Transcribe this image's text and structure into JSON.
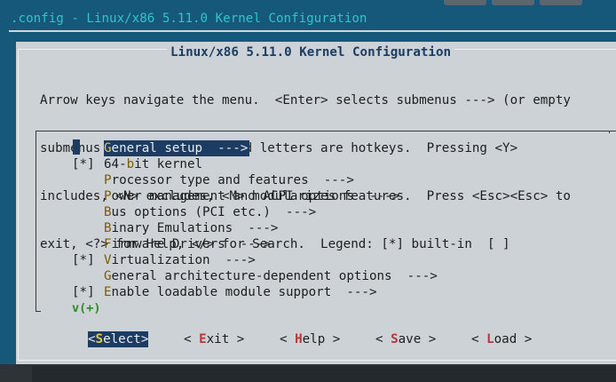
{
  "terminal": {
    "title": ".config - Linux/x86 5.11.0 Kernel Configuration"
  },
  "dialog": {
    "title": "Linux/x86 5.11.0 Kernel Configuration",
    "help_lines": [
      "Arrow keys navigate the menu.  <Enter> selects submenus ---> (or empty",
      "submenus ----).  Highlighted letters are hotkeys.  Pressing <Y>",
      "includes, <N> excludes, <M> modularizes features.  Press <Esc><Esc> to",
      "exit, <?> for Help, </> for Search.  Legend: [*] built-in  [ ]"
    ]
  },
  "menu": {
    "items": [
      {
        "prefix": "",
        "hotkey": "G",
        "rest": "eneral setup  --->"
      },
      {
        "prefix": "[*]",
        "pre": "64-",
        "hotkey": "b",
        "rest": "it kernel"
      },
      {
        "prefix": "",
        "hotkey": "P",
        "rest": "rocessor type and features  --->"
      },
      {
        "prefix": "",
        "hotkey": "P",
        "rest": "ower management and ACPI options  --->"
      },
      {
        "prefix": "",
        "hotkey": "B",
        "rest": "us options (PCI etc.)  --->"
      },
      {
        "prefix": "",
        "hotkey": "B",
        "rest": "inary Emulations  --->"
      },
      {
        "prefix": "",
        "hotkey": "F",
        "rest": "irmware Drivers  --->"
      },
      {
        "prefix": "[*]",
        "hotkey": "V",
        "rest": "irtualization  --->"
      },
      {
        "prefix": "",
        "hotkey": "G",
        "rest": "eneral architecture-dependent options  --->"
      },
      {
        "prefix": "[*]",
        "hotkey": "E",
        "rest": "nable loadable module support  --->"
      }
    ],
    "more_indicator": "v(+)"
  },
  "buttons": {
    "select": {
      "open": "<",
      "hotkey": "S",
      "rest": "elect",
      "close": ">"
    },
    "exit": {
      "open": "< ",
      "hotkey": "E",
      "rest": "xit",
      "close": " >"
    },
    "help": {
      "open": "< ",
      "hotkey": "H",
      "rest": "elp",
      "close": " >"
    },
    "save": {
      "open": "< ",
      "hotkey": "S",
      "rest": "ave",
      "close": " >"
    },
    "load": {
      "open": "< ",
      "hotkey": "L",
      "rest": "oad",
      "close": " >"
    }
  },
  "colors": {
    "background": "#15587a",
    "dialog": "#ccd2d6",
    "title": "#1c3c63",
    "highlight": "#1c3c63",
    "button_hotkey": "#b23a3a",
    "terminal_title": "#33c4c9"
  }
}
